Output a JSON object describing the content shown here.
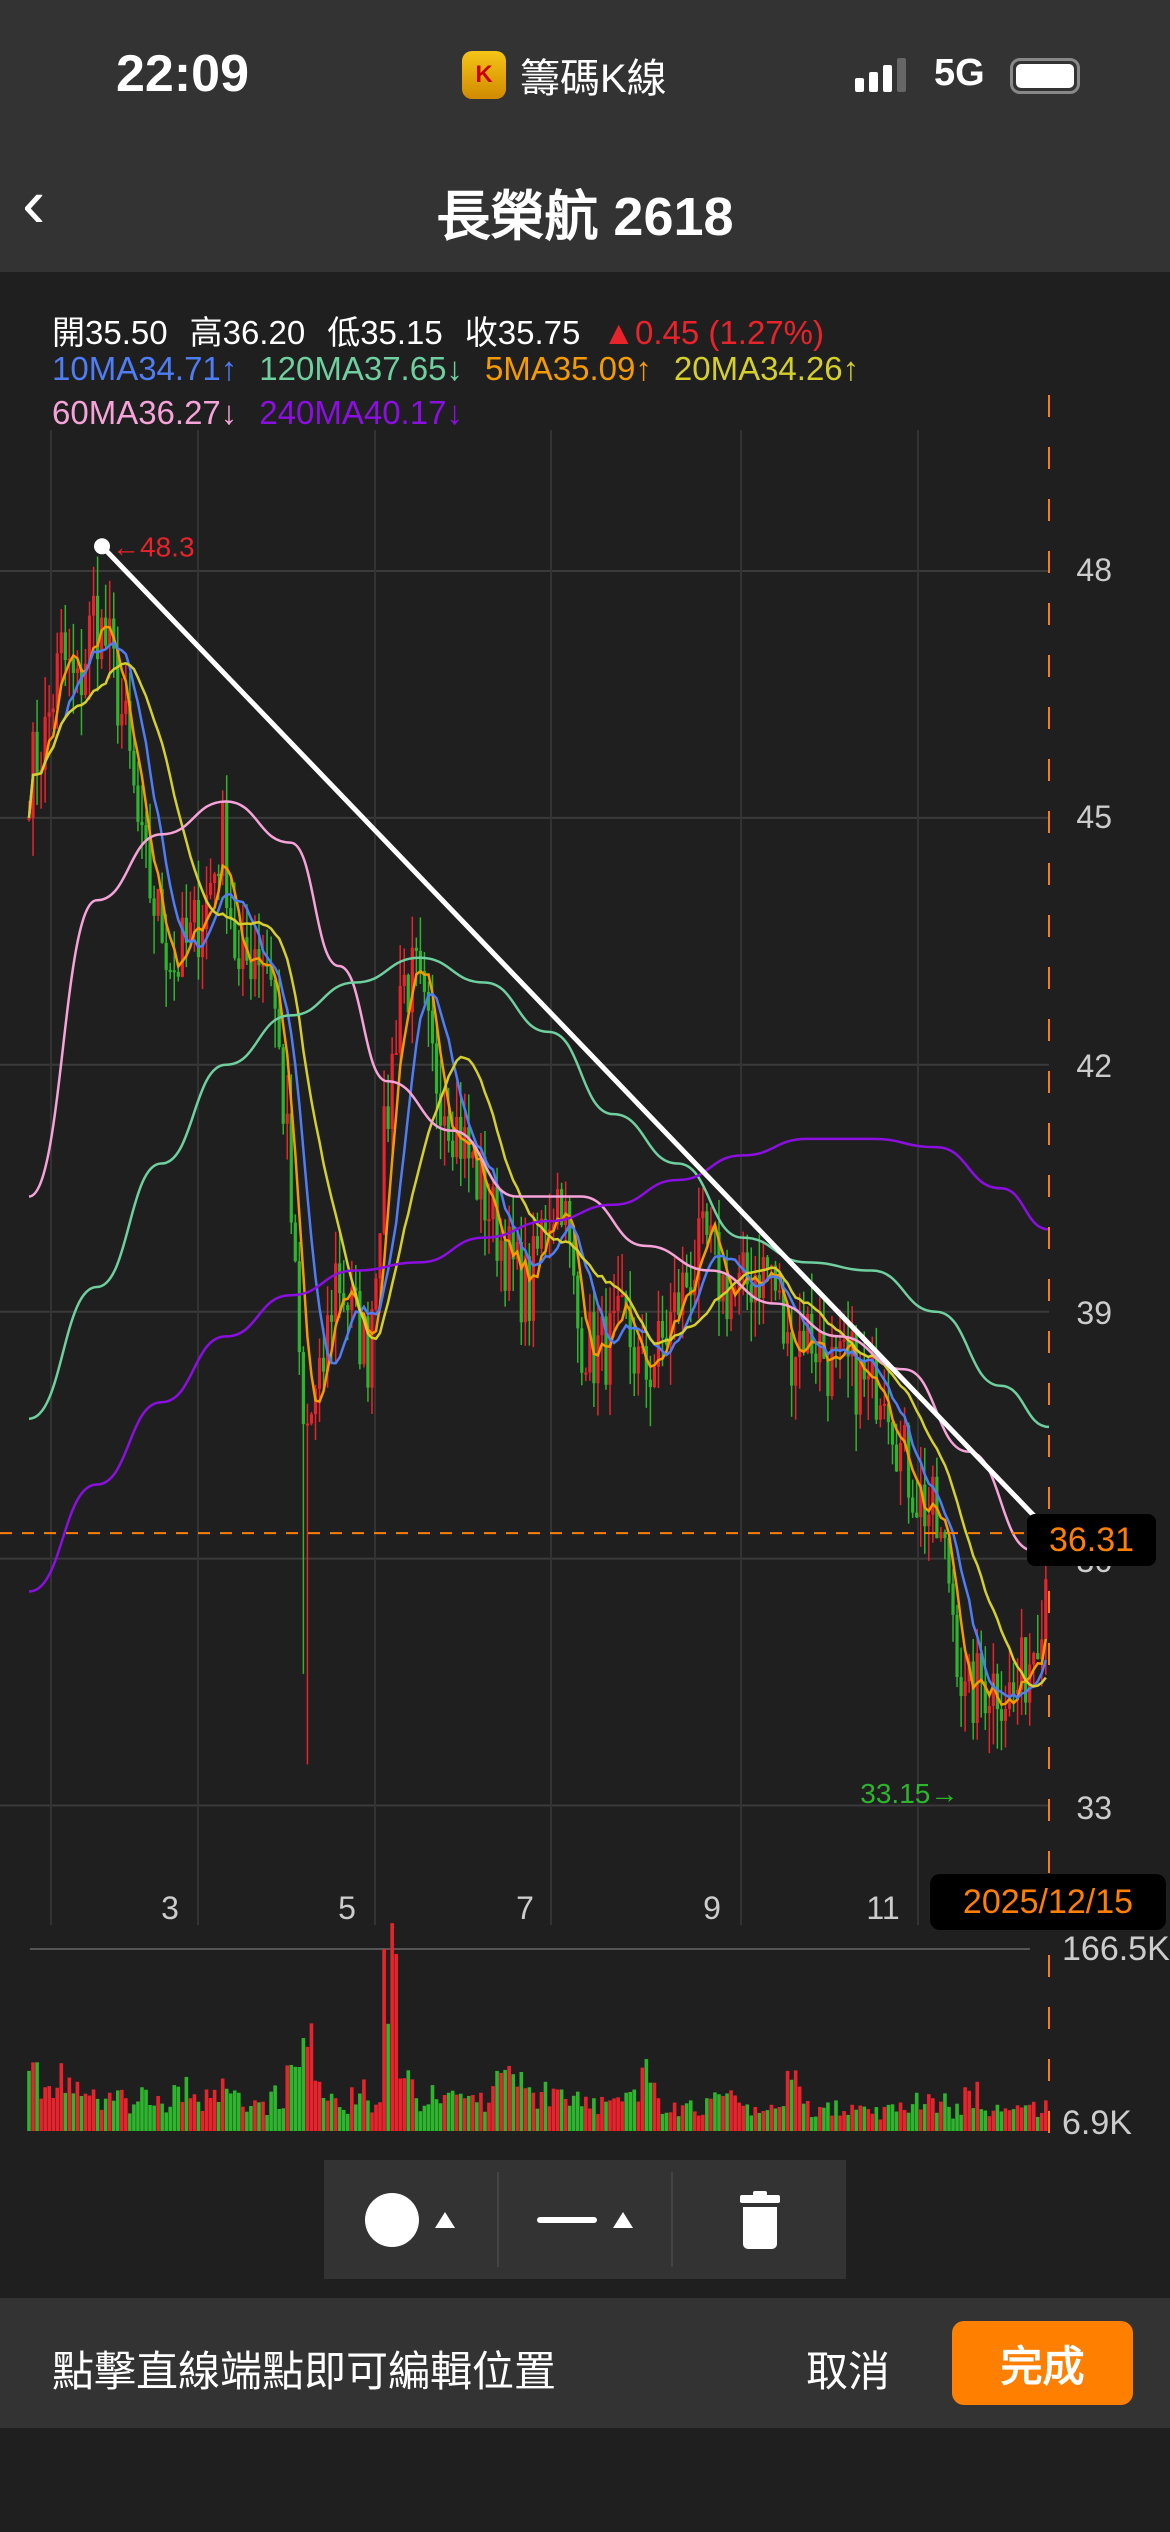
{
  "status": {
    "time": "22:09",
    "app_name": "籌碼K線",
    "app_icon_letter": "K",
    "network": "5G"
  },
  "nav": {
    "title": "長榮航 2618",
    "back_icon": "chevron-left-icon"
  },
  "ohlc": {
    "open": "開35.50",
    "high": "高36.20",
    "low": "低35.15",
    "close": "收35.75",
    "change": "▲0.45 (1.27%)"
  },
  "ma_labels": [
    {
      "text": "10MA34.71↑",
      "color": "#4f7df5"
    },
    {
      "text": "120MA37.65↓",
      "color": "#6fcf9f"
    },
    {
      "text": "5MA35.09↑",
      "color": "#f59b00"
    },
    {
      "text": "20MA34.26↑",
      "color": "#d4cf2a"
    },
    {
      "text": "60MA36.27↓",
      "color": "#f5a3d8"
    },
    {
      "text": "240MA40.17↓",
      "color": "#8a0fe0"
    }
  ],
  "colors": {
    "up": "#e8232b",
    "down": "#2db52d",
    "accent": "#ff7f00"
  },
  "chart_data": {
    "type": "candlestick",
    "price_ticks": [
      "48",
      "45",
      "42",
      "39",
      "36",
      "33"
    ],
    "price_tick_values": [
      48,
      45,
      42,
      39,
      36,
      33
    ],
    "x_ticks": [
      {
        "label": "3",
        "i": 14.2
      },
      {
        "label": "5",
        "i": 25.2
      },
      {
        "label": "7",
        "i": 36.2
      },
      {
        "label": "9",
        "i": 47.8
      },
      {
        "label": "11",
        "i": 58.3
      }
    ],
    "closes": [
      45.5,
      46,
      47,
      46.5,
      47.5,
      47,
      46,
      44.5,
      43.8,
      43.2,
      43.5,
      44,
      44.8,
      43,
      43.5,
      43.2,
      41,
      37.5,
      38,
      39.5,
      39,
      38.5,
      41,
      43,
      43,
      42,
      41.5,
      41,
      40.5,
      40,
      39.5,
      39.2,
      40.2,
      40.5,
      38.8,
      38.5,
      38.6,
      38.8,
      38.2,
      38.5,
      39,
      39.5,
      39.8,
      39.3,
      39.2,
      39.5,
      39.5,
      38.5,
      38.8,
      38.6,
      38.2,
      38.3,
      38,
      38.3,
      37.3,
      36.8,
      36.5,
      35.8,
      34.2,
      34.5,
      34.5,
      34.3,
      34.8,
      35.75
    ],
    "ma60": {
      "i": [
        0,
        4.2,
        8.2,
        12.2,
        16.2,
        19.2,
        22.2,
        26.2,
        30.2,
        34.2,
        38.2,
        42.2,
        46.2,
        50.2,
        54.2,
        58.2,
        62.2
      ],
      "v": [
        40.4,
        44,
        44.8,
        45.2,
        44.7,
        43.2,
        41.8,
        41.2,
        40.4,
        40.4,
        39.8,
        39.5,
        39.1,
        38.7,
        38.3,
        37.3,
        36.1
      ]
    },
    "ma120": {
      "i": [
        0,
        4.2,
        8.2,
        12.2,
        16.2,
        20.2,
        24.2,
        28.2,
        32.2,
        36.2,
        40.2,
        44.2,
        48.2,
        52.2,
        56.2,
        60.2,
        63.2
      ],
      "v": [
        37.7,
        39.3,
        40.8,
        42,
        42.6,
        43,
        43.3,
        43,
        42.4,
        41.4,
        40.8,
        39.9,
        39.6,
        39.5,
        39,
        38.1,
        37.6
      ]
    },
    "ma240": {
      "i": [
        0,
        4.2,
        8.2,
        12.2,
        16.2,
        20.2,
        24.2,
        28.2,
        32.2,
        36.2,
        40.2,
        44.2,
        48.2,
        52.2,
        56.2,
        60.2,
        63.2
      ],
      "v": [
        35.6,
        36.9,
        37.9,
        38.7,
        39.2,
        39.5,
        39.6,
        39.9,
        40.1,
        40.3,
        40.6,
        40.9,
        41.1,
        41.1,
        41,
        40.5,
        40
      ]
    },
    "volumes_k": [
      55,
      40,
      62,
      45,
      38,
      35,
      30,
      40,
      32,
      42,
      30,
      38,
      48,
      35,
      28,
      36,
      60,
      85,
      45,
      30,
      40,
      28,
      166.5,
      48,
      30,
      42,
      35,
      30,
      35,
      55,
      52,
      40,
      45,
      38,
      36,
      30,
      28,
      35,
      58,
      30,
      26,
      28,
      30,
      32,
      26,
      22,
      24,
      55,
      25,
      22,
      28,
      24,
      20,
      22,
      26,
      35,
      30,
      22,
      40,
      20,
      24,
      20,
      24,
      28
    ],
    "volume_max_label": "166.5K",
    "volume_min_label": "6.9K",
    "trendline": {
      "start_i": 4.4,
      "start_price": 48.3,
      "end_i": 63.3,
      "end_price": 36.31
    },
    "high_marker": {
      "text": "←48.3",
      "i": 4.4,
      "price": 48.3
    },
    "low_marker": {
      "text": "33.15→",
      "i": 58.2,
      "price": 33.15
    },
    "current_price_label": "36.31",
    "cursor_date": "2025/12/15"
  },
  "toolbar": {
    "color_icon": "circle-color-icon",
    "line_icon": "line-style-icon",
    "delete_icon": "trash-icon"
  },
  "bottom": {
    "hint": "點擊直線端點即可編輯位置",
    "cancel": "取消",
    "done": "完成"
  }
}
